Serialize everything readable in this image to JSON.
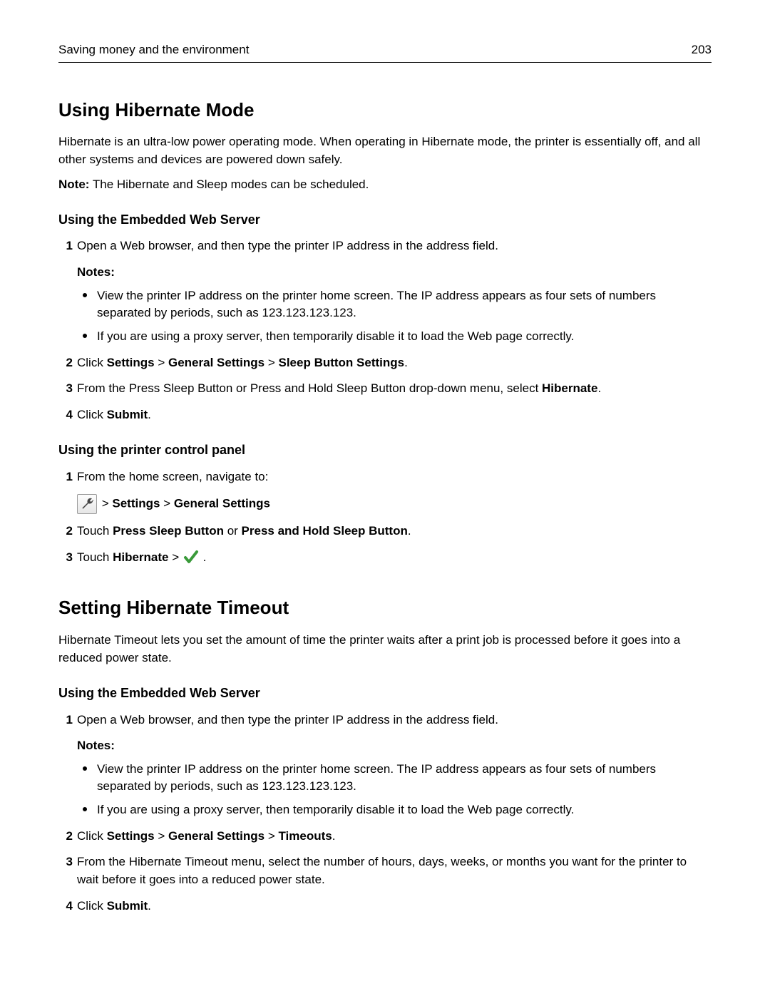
{
  "header": {
    "section_title": "Saving money and the environment",
    "page_number": "203"
  },
  "section_a": {
    "title": "Using Hibernate Mode",
    "intro": "Hibernate is an ultra-low power operating mode. When operating in Hibernate mode, the printer is essentially off, and all other systems and devices are powered down safely.",
    "note_label": "Note:",
    "note_text": " The Hibernate and Sleep modes can be scheduled.",
    "sub_ews": {
      "title": "Using the Embedded Web Server",
      "step1": "Open a Web browser, and then type the printer IP address in the address field.",
      "notes_label": "Notes:",
      "bullet1": "View the printer IP address on the printer home screen. The IP address appears as four sets of numbers separated by periods, such as 123.123.123.123.",
      "bullet2": "If you are using a proxy server, then temporarily disable it to load the Web page correctly.",
      "step2_pre": "Click ",
      "step2_b1": "Settings",
      "step2_sep": " > ",
      "step2_b2": "General Settings",
      "step2_b3": "Sleep Button Settings",
      "step2_end": ".",
      "step3_pre": "From the Press Sleep Button or Press and Hold Sleep Button drop-down menu, select ",
      "step3_b1": "Hibernate",
      "step3_end": ".",
      "step4_pre": "Click ",
      "step4_b1": "Submit",
      "step4_end": "."
    },
    "sub_panel": {
      "title": "Using the printer control panel",
      "step1": "From the home screen, navigate to:",
      "nav_sep": " > ",
      "nav_b1": "Settings",
      "nav_b2": "General Settings",
      "step2_pre": "Touch ",
      "step2_b1": "Press Sleep Button",
      "step2_mid": " or ",
      "step2_b2": "Press and Hold Sleep Button",
      "step2_end": ".",
      "step3_pre": "Touch ",
      "step3_b1": "Hibernate",
      "step3_sep": " > ",
      "step3_end": " ."
    }
  },
  "section_b": {
    "title": "Setting Hibernate Timeout",
    "intro": "Hibernate Timeout lets you set the amount of time the printer waits after a print job is processed before it goes into a reduced power state.",
    "sub_ews": {
      "title": "Using the Embedded Web Server",
      "step1": "Open a Web browser, and then type the printer IP address in the address field.",
      "notes_label": "Notes:",
      "bullet1": "View the printer IP address on the printer home screen. The IP address appears as four sets of numbers separated by periods, such as 123.123.123.123.",
      "bullet2": "If you are using a proxy server, then temporarily disable it to load the Web page correctly.",
      "step2_pre": "Click ",
      "step2_b1": "Settings",
      "step2_sep": " > ",
      "step2_b2": "General Settings",
      "step2_b3": "Timeouts",
      "step2_end": ".",
      "step3": "From the Hibernate Timeout menu, select the number of hours, days, weeks, or months you want for the printer to wait before it goes into a reduced power state.",
      "step4_pre": "Click ",
      "step4_b1": "Submit",
      "step4_end": "."
    }
  },
  "numbers": {
    "n1": "1",
    "n2": "2",
    "n3": "3",
    "n4": "4"
  }
}
